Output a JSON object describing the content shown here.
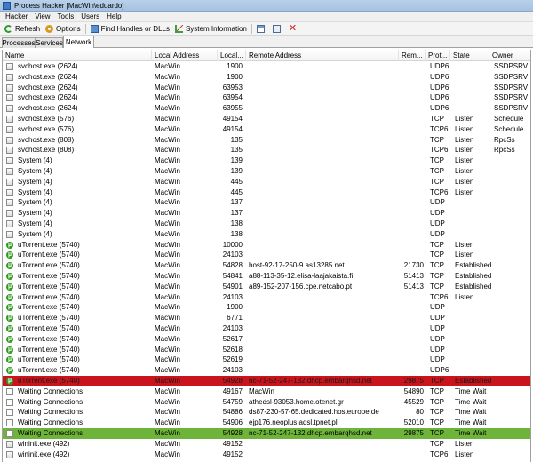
{
  "window": {
    "title": "Process Hacker [MacWin\\eduardo]"
  },
  "menu": [
    "Hacker",
    "View",
    "Tools",
    "Users",
    "Help"
  ],
  "toolbar": {
    "refresh": "Refresh",
    "options": "Options",
    "find_handles": "Find Handles or DLLs",
    "system_information": "System Information"
  },
  "tabs": [
    "Processes",
    "Services",
    "Network"
  ],
  "active_tab": "Network",
  "columns": {
    "name": "Name",
    "local_address": "Local Address",
    "local_port": "Local...",
    "remote_address": "Remote Address",
    "remote_port": "Rem...",
    "protocol": "Prot...",
    "state": "State",
    "owner": "Owner"
  },
  "row_colors": {
    "red": "#c8141c",
    "green": "#6fb43a"
  },
  "rows": [
    {
      "icon": "service",
      "name": "svchost.exe (2624)",
      "local": "MacWin",
      "lport": "1900",
      "remote": "",
      "rport": "",
      "proto": "UDP6",
      "state": "",
      "owner": "SSDPSRV"
    },
    {
      "icon": "service",
      "name": "svchost.exe (2624)",
      "local": "MacWin",
      "lport": "1900",
      "remote": "",
      "rport": "",
      "proto": "UDP6",
      "state": "",
      "owner": "SSDPSRV"
    },
    {
      "icon": "service",
      "name": "svchost.exe (2624)",
      "local": "MacWin",
      "lport": "63953",
      "remote": "",
      "rport": "",
      "proto": "UDP6",
      "state": "",
      "owner": "SSDPSRV"
    },
    {
      "icon": "service",
      "name": "svchost.exe (2624)",
      "local": "MacWin",
      "lport": "63954",
      "remote": "",
      "rport": "",
      "proto": "UDP6",
      "state": "",
      "owner": "SSDPSRV"
    },
    {
      "icon": "service",
      "name": "svchost.exe (2624)",
      "local": "MacWin",
      "lport": "63955",
      "remote": "",
      "rport": "",
      "proto": "UDP6",
      "state": "",
      "owner": "SSDPSRV"
    },
    {
      "icon": "service",
      "name": "svchost.exe (576)",
      "local": "MacWin",
      "lport": "49154",
      "remote": "",
      "rport": "",
      "proto": "TCP",
      "state": "Listen",
      "owner": "Schedule"
    },
    {
      "icon": "service",
      "name": "svchost.exe (576)",
      "local": "MacWin",
      "lport": "49154",
      "remote": "",
      "rport": "",
      "proto": "TCP6",
      "state": "Listen",
      "owner": "Schedule"
    },
    {
      "icon": "service",
      "name": "svchost.exe (808)",
      "local": "MacWin",
      "lport": "135",
      "remote": "",
      "rport": "",
      "proto": "TCP",
      "state": "Listen",
      "owner": "RpcSs"
    },
    {
      "icon": "service",
      "name": "svchost.exe (808)",
      "local": "MacWin",
      "lport": "135",
      "remote": "",
      "rport": "",
      "proto": "TCP6",
      "state": "Listen",
      "owner": "RpcSs"
    },
    {
      "icon": "service",
      "name": "System (4)",
      "local": "MacWin",
      "lport": "139",
      "remote": "",
      "rport": "",
      "proto": "TCP",
      "state": "Listen",
      "owner": ""
    },
    {
      "icon": "service",
      "name": "System (4)",
      "local": "MacWin",
      "lport": "139",
      "remote": "",
      "rport": "",
      "proto": "TCP",
      "state": "Listen",
      "owner": ""
    },
    {
      "icon": "service",
      "name": "System (4)",
      "local": "MacWin",
      "lport": "445",
      "remote": "",
      "rport": "",
      "proto": "TCP",
      "state": "Listen",
      "owner": ""
    },
    {
      "icon": "service",
      "name": "System (4)",
      "local": "MacWin",
      "lport": "445",
      "remote": "",
      "rport": "",
      "proto": "TCP6",
      "state": "Listen",
      "owner": ""
    },
    {
      "icon": "service",
      "name": "System (4)",
      "local": "MacWin",
      "lport": "137",
      "remote": "",
      "rport": "",
      "proto": "UDP",
      "state": "",
      "owner": ""
    },
    {
      "icon": "service",
      "name": "System (4)",
      "local": "MacWin",
      "lport": "137",
      "remote": "",
      "rport": "",
      "proto": "UDP",
      "state": "",
      "owner": ""
    },
    {
      "icon": "service",
      "name": "System (4)",
      "local": "MacWin",
      "lport": "138",
      "remote": "",
      "rport": "",
      "proto": "UDP",
      "state": "",
      "owner": ""
    },
    {
      "icon": "service",
      "name": "System (4)",
      "local": "MacWin",
      "lport": "138",
      "remote": "",
      "rport": "",
      "proto": "UDP",
      "state": "",
      "owner": ""
    },
    {
      "icon": "utorrent",
      "name": "uTorrent.exe (5740)",
      "local": "MacWin",
      "lport": "10000",
      "remote": "",
      "rport": "",
      "proto": "TCP",
      "state": "Listen",
      "owner": ""
    },
    {
      "icon": "utorrent",
      "name": "uTorrent.exe (5740)",
      "local": "MacWin",
      "lport": "24103",
      "remote": "",
      "rport": "",
      "proto": "TCP",
      "state": "Listen",
      "owner": ""
    },
    {
      "icon": "utorrent",
      "name": "uTorrent.exe (5740)",
      "local": "MacWin",
      "lport": "54828",
      "remote": "host-92-17-250-9.as13285.net",
      "rport": "21730",
      "proto": "TCP",
      "state": "Established",
      "owner": ""
    },
    {
      "icon": "utorrent",
      "name": "uTorrent.exe (5740)",
      "local": "MacWin",
      "lport": "54841",
      "remote": "a88-113-35-12.elisa-laajakaista.fi",
      "rport": "51413",
      "proto": "TCP",
      "state": "Established",
      "owner": ""
    },
    {
      "icon": "utorrent",
      "name": "uTorrent.exe (5740)",
      "local": "MacWin",
      "lport": "54901",
      "remote": "a89-152-207-156.cpe.netcabo.pt",
      "rport": "51413",
      "proto": "TCP",
      "state": "Established",
      "owner": ""
    },
    {
      "icon": "utorrent",
      "name": "uTorrent.exe (5740)",
      "local": "MacWin",
      "lport": "24103",
      "remote": "",
      "rport": "",
      "proto": "TCP6",
      "state": "Listen",
      "owner": ""
    },
    {
      "icon": "utorrent",
      "name": "uTorrent.exe (5740)",
      "local": "MacWin",
      "lport": "1900",
      "remote": "",
      "rport": "",
      "proto": "UDP",
      "state": "",
      "owner": ""
    },
    {
      "icon": "utorrent",
      "name": "uTorrent.exe (5740)",
      "local": "MacWin",
      "lport": "6771",
      "remote": "",
      "rport": "",
      "proto": "UDP",
      "state": "",
      "owner": ""
    },
    {
      "icon": "utorrent",
      "name": "uTorrent.exe (5740)",
      "local": "MacWin",
      "lport": "24103",
      "remote": "",
      "rport": "",
      "proto": "UDP",
      "state": "",
      "owner": ""
    },
    {
      "icon": "utorrent",
      "name": "uTorrent.exe (5740)",
      "local": "MacWin",
      "lport": "52617",
      "remote": "",
      "rport": "",
      "proto": "UDP",
      "state": "",
      "owner": ""
    },
    {
      "icon": "utorrent",
      "name": "uTorrent.exe (5740)",
      "local": "MacWin",
      "lport": "52618",
      "remote": "",
      "rport": "",
      "proto": "UDP",
      "state": "",
      "owner": ""
    },
    {
      "icon": "utorrent",
      "name": "uTorrent.exe (5740)",
      "local": "MacWin",
      "lport": "52619",
      "remote": "",
      "rport": "",
      "proto": "UDP",
      "state": "",
      "owner": ""
    },
    {
      "icon": "utorrent",
      "name": "uTorrent.exe (5740)",
      "local": "MacWin",
      "lport": "24103",
      "remote": "",
      "rport": "",
      "proto": "UDP6",
      "state": "",
      "owner": ""
    },
    {
      "icon": "utorrent",
      "name": "uTorrent.exe (5740)",
      "local": "MacWin",
      "lport": "54928",
      "remote": "nc-71-52-247-132.dhcp.embarqhsd.net",
      "rport": "29875",
      "proto": "TCP",
      "state": "Established",
      "owner": "",
      "highlight": "red"
    },
    {
      "icon": "wait",
      "name": "Waiting Connections",
      "local": "MacWin",
      "lport": "49167",
      "remote": "MacWin",
      "rport": "54890",
      "proto": "TCP",
      "state": "Time Wait",
      "owner": ""
    },
    {
      "icon": "wait",
      "name": "Waiting Connections",
      "local": "MacWin",
      "lport": "54759",
      "remote": "athedsl-93053.home.otenet.gr",
      "rport": "45529",
      "proto": "TCP",
      "state": "Time Wait",
      "owner": ""
    },
    {
      "icon": "wait",
      "name": "Waiting Connections",
      "local": "MacWin",
      "lport": "54886",
      "remote": "ds87-230-57-65.dedicated.hosteurope.de",
      "rport": "80",
      "proto": "TCP",
      "state": "Time Wait",
      "owner": ""
    },
    {
      "icon": "wait",
      "name": "Waiting Connections",
      "local": "MacWin",
      "lport": "54906",
      "remote": "ejp176.neoplus.adsl.tpnet.pl",
      "rport": "52010",
      "proto": "TCP",
      "state": "Time Wait",
      "owner": ""
    },
    {
      "icon": "wait",
      "name": "Waiting Connections",
      "local": "MacWin",
      "lport": "54928",
      "remote": "nc-71-52-247-132.dhcp.embarqhsd.net",
      "rport": "29875",
      "proto": "TCP",
      "state": "Time Wait",
      "owner": "",
      "highlight": "green"
    },
    {
      "icon": "service",
      "name": "wininit.exe (492)",
      "local": "MacWin",
      "lport": "49152",
      "remote": "",
      "rport": "",
      "proto": "TCP",
      "state": "Listen",
      "owner": ""
    },
    {
      "icon": "service",
      "name": "wininit.exe (492)",
      "local": "MacWin",
      "lport": "49152",
      "remote": "",
      "rport": "",
      "proto": "TCP6",
      "state": "Listen",
      "owner": ""
    }
  ]
}
